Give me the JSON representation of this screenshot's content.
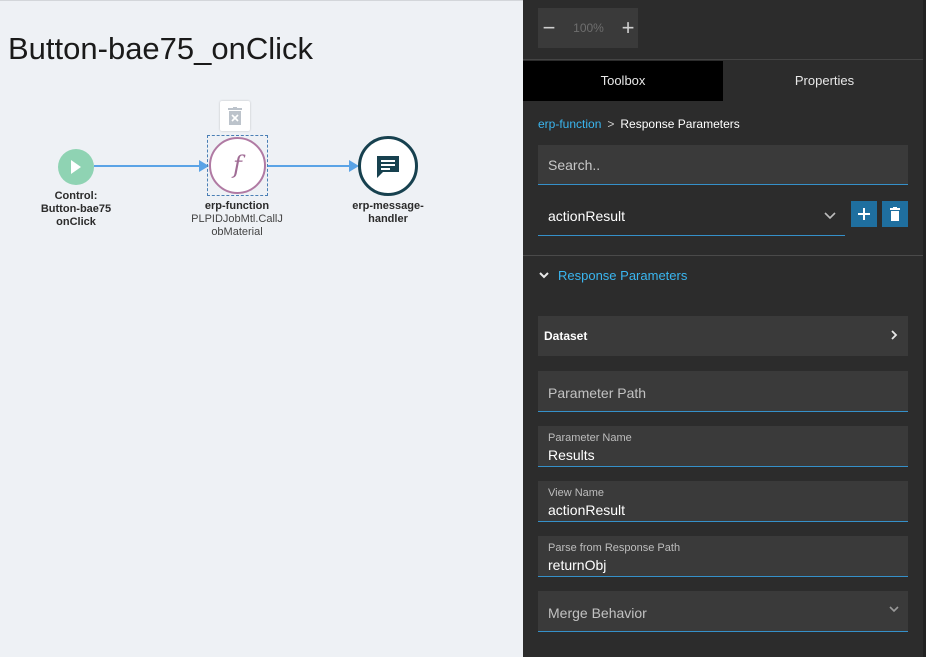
{
  "canvas": {
    "title": "Button-bae75_onClick",
    "nodes": {
      "start": {
        "title": "Control:",
        "line2": "Button-bae75",
        "line3": "onClick",
        "icon": "play-icon"
      },
      "function": {
        "title": "erp-function",
        "line2": "PLPIDJobMtl.CallJ",
        "line3": "obMaterial",
        "glyph": "f",
        "icon": "function-icon"
      },
      "message": {
        "title": "erp-message-",
        "line2": "handler",
        "icon": "message-icon"
      }
    },
    "delete_icon": "trash-icon"
  },
  "zoom": {
    "minus": "−",
    "plus": "+",
    "level": "100%"
  },
  "tabs": {
    "toolbox": "Toolbox",
    "properties": "Properties"
  },
  "breadcrumb": {
    "parent": "erp-function",
    "separator": ">",
    "current": "Response Parameters"
  },
  "search": {
    "placeholder": "Search.."
  },
  "view_select": {
    "value": "actionResult"
  },
  "section": {
    "label": "Response Parameters"
  },
  "dataset": {
    "label": "Dataset"
  },
  "fields": {
    "parameter_path": {
      "placeholder": "Parameter Path"
    },
    "parameter_name": {
      "label": "Parameter Name",
      "value": "Results"
    },
    "view_name": {
      "label": "View Name",
      "value": "actionResult"
    },
    "parse_path": {
      "label": "Parse from Response Path",
      "value": "returnObj"
    },
    "merge_behavior": {
      "placeholder": "Merge Behavior"
    }
  },
  "colors": {
    "accent": "#3ab6f0",
    "panel_bg": "#2c2c2c",
    "field_bg": "#3a3a3a",
    "start_node": "#8fd3b3",
    "function_node": "#b07aa3",
    "message_node": "#17414f",
    "edge": "#5aa3e6",
    "button": "#1f6f9f"
  }
}
